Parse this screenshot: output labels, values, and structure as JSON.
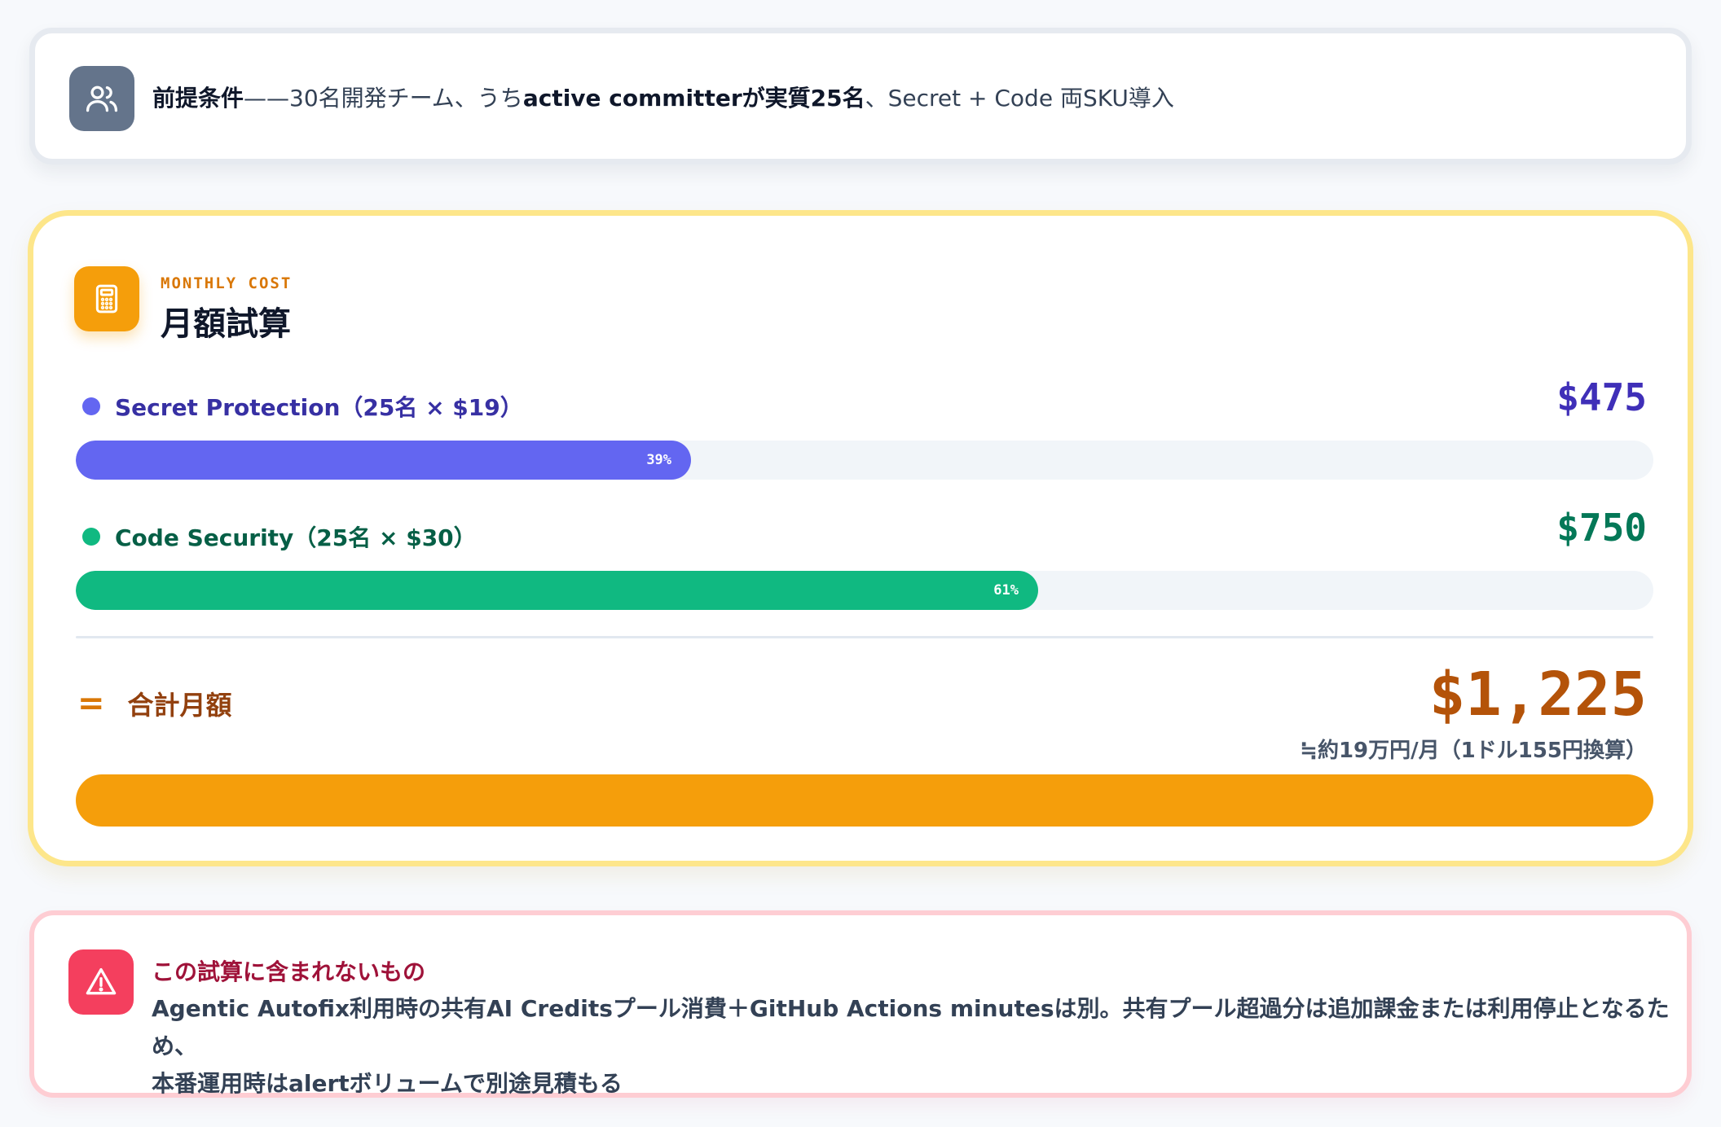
{
  "premise": {
    "icon": "users-icon",
    "label": "前提条件",
    "dash": "——",
    "text_1": "30名開発チーム、うち",
    "active": "active committerが実質25名",
    "text_2": "、Secret + Code 両SKU導入"
  },
  "monthly": {
    "icon": "calculator-icon",
    "eyebrow": "MONTHLY COST",
    "title": "月額試算",
    "items": [
      {
        "label": "Secret Protection（25名 × $19）",
        "amount": "$475",
        "percent_label": "39%",
        "share": 0.39,
        "color": "#6366f1",
        "text_color": "#3730a3",
        "amount_color": "#3f2fb8"
      },
      {
        "label": "Code Security（25名 × $30）",
        "amount": "$750",
        "percent_label": "61%",
        "share": 0.61,
        "color": "#10b981",
        "text_color": "#065f46",
        "amount_color": "#047857"
      }
    ],
    "total": {
      "symbol": "=",
      "label": "合計月額",
      "amount": "$1,225",
      "note": "≒約19万円/月（1ドル155円換算）",
      "color": "#f59e0b"
    }
  },
  "exclusions": {
    "icon": "warning-triangle-icon",
    "title": "この試算に含まれないもの",
    "line_1": "Agentic Autofix利用時の共有AI Creditsプール消費＋GitHub Actions minutesは別。共有プール超過分は追加課金または利用停止となるため、",
    "line_2": "本番運用時はalertボリュームで別途見積もる"
  }
}
